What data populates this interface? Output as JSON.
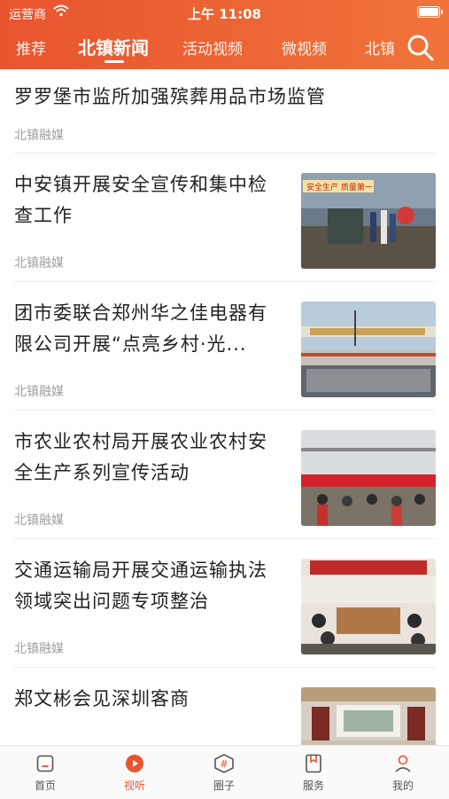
{
  "status_bar": {
    "carrier": "运营商",
    "time": "上午 11:08"
  },
  "tabs": [
    {
      "label": "推荐"
    },
    {
      "label": "北镇新闻"
    },
    {
      "label": "活动视频"
    },
    {
      "label": "微视频"
    },
    {
      "label": "北镇"
    }
  ],
  "active_tab": "北镇新闻",
  "news": [
    {
      "title": "罗罗堡市监所加强殡葬用品市场监管",
      "source": "北镇融媒"
    },
    {
      "title_line1": "中安镇开展安全宣传和集中检",
      "title_line2": "查工作",
      "source": "北镇融媒",
      "image_caption": "安全生产 质量第一"
    },
    {
      "title_line1": "团市委联合郑州华之佳电器有",
      "title_line2": "限公司开展“点亮乡村·光...",
      "source": "北镇融媒"
    },
    {
      "title_line1": "市农业农村局开展农业农村安",
      "title_line2": "全生产系列宣传活动",
      "source": "北镇融媒"
    },
    {
      "title_line1": "交通运输局开展交通运输执法",
      "title_line2": "领域突出问题专项整治",
      "source": "北镇融媒"
    },
    {
      "title": "郑文彬会见深圳客商",
      "source": ""
    }
  ],
  "bottom_nav": [
    {
      "label": "首页",
      "icon": "home-icon"
    },
    {
      "label": "视听",
      "icon": "play-icon"
    },
    {
      "label": "圈子",
      "icon": "hashtag-icon"
    },
    {
      "label": "服务",
      "icon": "bookmark-icon"
    },
    {
      "label": "我的",
      "icon": "user-icon"
    }
  ],
  "colors": {
    "accent": "#e8542e",
    "accent_light": "#f0743a"
  }
}
